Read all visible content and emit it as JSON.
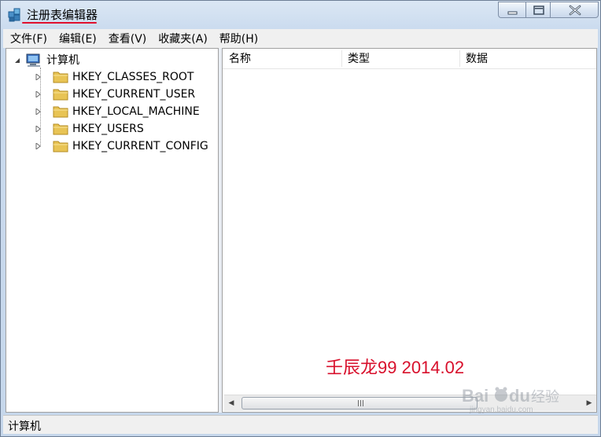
{
  "window": {
    "title": "注册表编辑器"
  },
  "menu": [
    "文件(F)",
    "编辑(E)",
    "查看(V)",
    "收藏夹(A)",
    "帮助(H)"
  ],
  "tree": {
    "root": "计算机",
    "items": [
      {
        "label": "HKEY_CLASSES_ROOT"
      },
      {
        "label": "HKEY_CURRENT_USER"
      },
      {
        "label": "HKEY_LOCAL_MACHINE"
      },
      {
        "label": "HKEY_USERS"
      },
      {
        "label": "HKEY_CURRENT_CONFIG"
      }
    ]
  },
  "list": {
    "columns": [
      "名称",
      "类型",
      "数据"
    ]
  },
  "overlay": {
    "text": "壬辰龙99 2014.02"
  },
  "status": {
    "path": "计算机"
  },
  "colors": {
    "accent_red": "#d8102c",
    "title_underline": "#e0102e"
  },
  "icons": [
    "regedit-app-icon",
    "computer-icon",
    "folder-icon",
    "minimize-icon",
    "maximize-icon",
    "close-icon",
    "expand-arrow-icon",
    "collapse-arrow-icon",
    "scroll-left-icon",
    "scroll-right-icon",
    "baidu-logo"
  ]
}
